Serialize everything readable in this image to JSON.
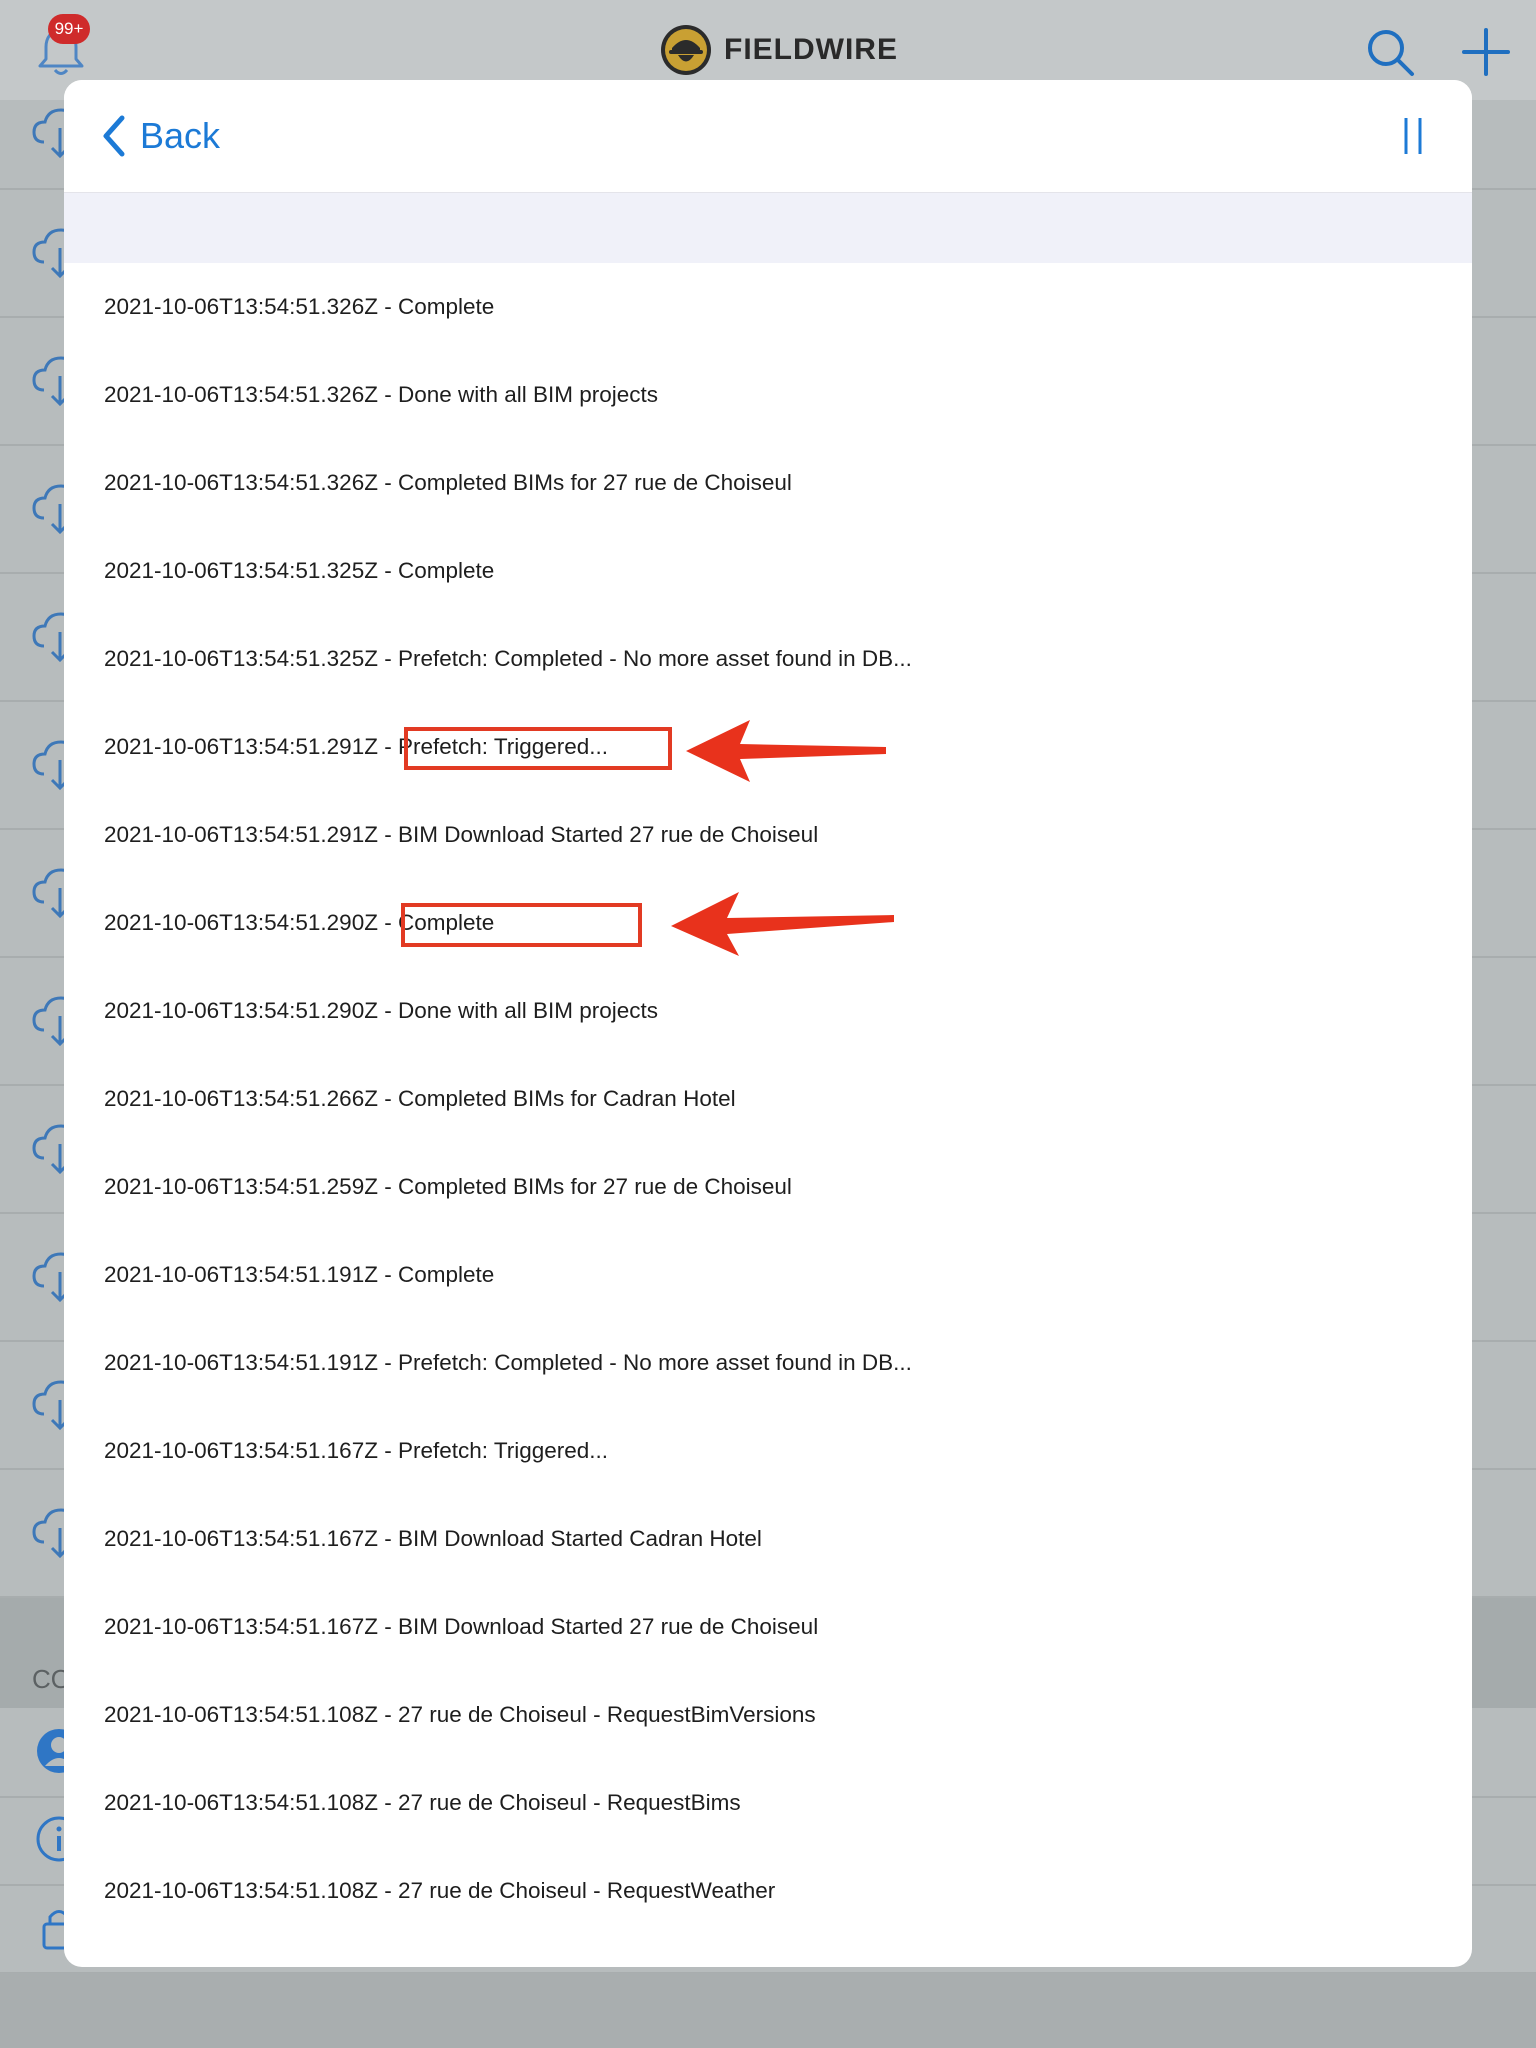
{
  "top_bar": {
    "notification_badge": "99+",
    "brand_name": "FIELDWIRE",
    "icons": [
      "bell-icon",
      "search-icon",
      "plus-icon"
    ]
  },
  "background": {
    "section_label": "CO",
    "row_icons": [
      "cloud-download-icon",
      "account-icon",
      "info-icon",
      "lock-icon"
    ]
  },
  "sheet": {
    "back_label": "Back",
    "pause_icon": "pause-icon",
    "log_entries": [
      "2021-10-06T13:54:51.326Z - Complete",
      "2021-10-06T13:54:51.326Z - Done with all BIM projects",
      "2021-10-06T13:54:51.326Z - Completed BIMs for 27 rue de Choiseul",
      "2021-10-06T13:54:51.325Z - Complete",
      "2021-10-06T13:54:51.325Z - Prefetch: Completed - No more asset found in DB...",
      "2021-10-06T13:54:51.291Z - Prefetch: Triggered...",
      "2021-10-06T13:54:51.291Z - BIM Download Started 27 rue de Choiseul",
      "2021-10-06T13:54:51.290Z - Complete",
      "2021-10-06T13:54:51.290Z - Done with all BIM projects",
      "2021-10-06T13:54:51.266Z - Completed BIMs for Cadran Hotel",
      "2021-10-06T13:54:51.259Z - Completed BIMs for 27 rue de Choiseul",
      "2021-10-06T13:54:51.191Z - Complete",
      "2021-10-06T13:54:51.191Z - Prefetch: Completed - No more asset found in DB...",
      "2021-10-06T13:54:51.167Z - Prefetch: Triggered...",
      "2021-10-06T13:54:51.167Z - BIM Download Started Cadran Hotel",
      "2021-10-06T13:54:51.167Z - BIM Download Started 27 rue de Choiseul",
      "2021-10-06T13:54:51.108Z - 27 rue de Choiseul - RequestBimVersions",
      "2021-10-06T13:54:51.108Z - 27 rue de Choiseul - RequestBims",
      "2021-10-06T13:54:51.108Z - 27 rue de Choiseul - RequestWeather"
    ]
  },
  "colors": {
    "accent": "#1c7ad6",
    "annotation": "#e23a23",
    "badge": "#cf2b2b"
  }
}
